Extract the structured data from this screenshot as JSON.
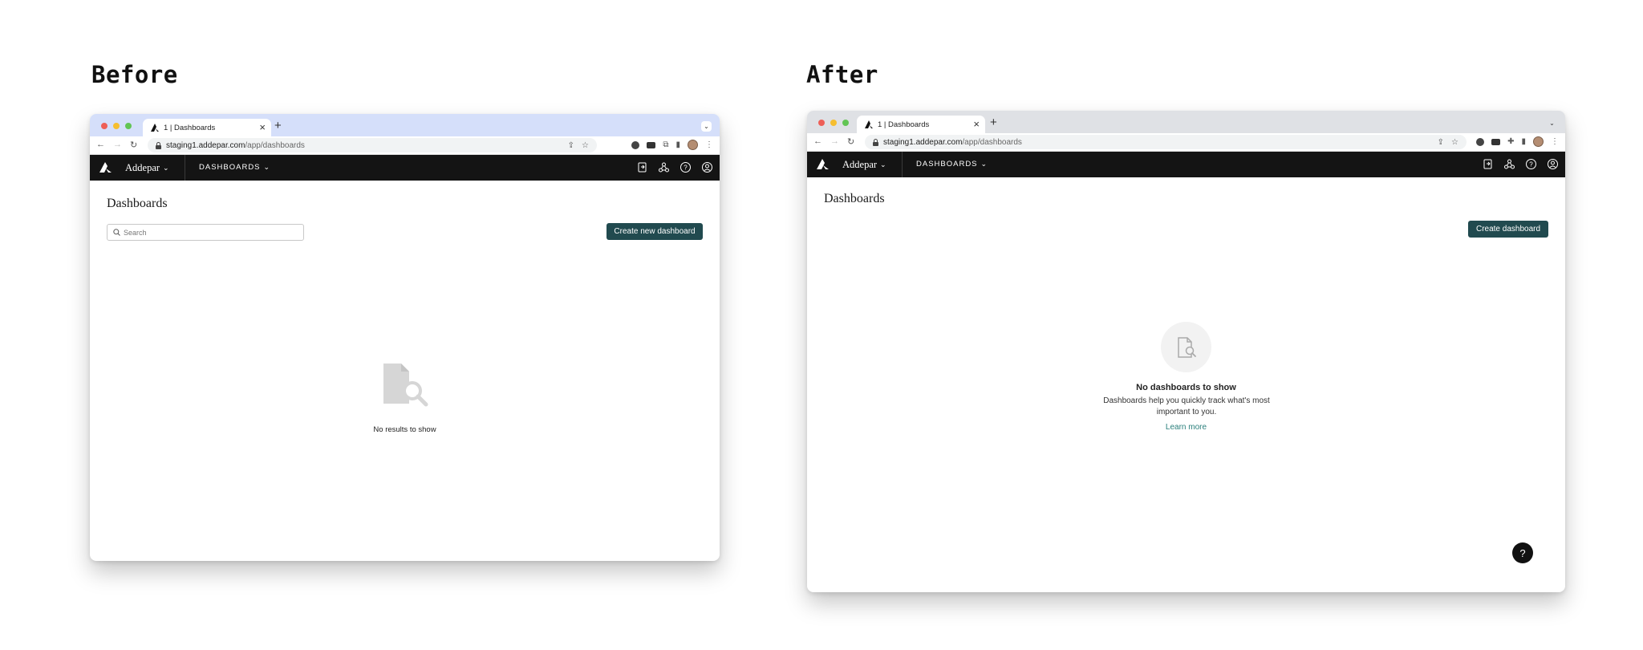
{
  "labels": {
    "before": "Before",
    "after": "After"
  },
  "colors": {
    "before_chrome": "#d5dffa",
    "after_chrome": "#dfe1e5",
    "app_bar": "#141414",
    "primary_button": "#214a4f",
    "learn_more_link": "#2a7f7b",
    "dot_red": "#ee5f57",
    "dot_yellow": "#f6be2f",
    "dot_green": "#62c554"
  },
  "before": {
    "browser": {
      "tab_title": "1 | Dashboards",
      "url_domain": "staging1.addepar.com",
      "url_path": "/app/dashboards"
    },
    "app": {
      "brand": "Addepar",
      "nav_label": "DASHBOARDS",
      "page_title": "Dashboards",
      "search_placeholder": "Search",
      "create_button": "Create new dashboard",
      "empty_text": "No results to show"
    }
  },
  "after": {
    "browser": {
      "tab_title": "1 | Dashboards",
      "url_domain": "staging1.addepar.com",
      "url_path": "/app/dashboards"
    },
    "app": {
      "brand": "Addepar",
      "nav_label": "DASHBOARDS",
      "page_title": "Dashboards",
      "create_button": "Create dashboard",
      "empty_title": "No dashboards to show",
      "empty_description": "Dashboards help you quickly track what's most important to you.",
      "learn_more": "Learn more",
      "help_button": "?"
    }
  }
}
